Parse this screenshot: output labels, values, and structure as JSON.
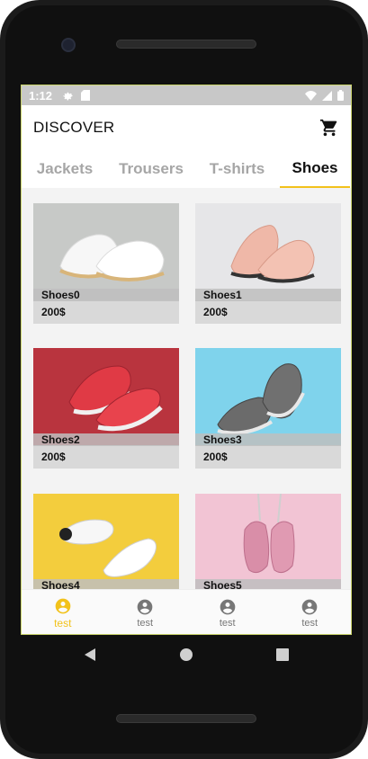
{
  "status_bar": {
    "time": "1:12"
  },
  "app_bar": {
    "title": "DISCOVER"
  },
  "tabs": [
    {
      "label": "Jackets",
      "active": false
    },
    {
      "label": "Trousers",
      "active": false
    },
    {
      "label": "T-shirts",
      "active": false
    },
    {
      "label": "Shoes",
      "active": true
    }
  ],
  "products": [
    {
      "name": "Shoes0",
      "price": "200$"
    },
    {
      "name": "Shoes1",
      "price": "200$"
    },
    {
      "name": "Shoes2",
      "price": "200$"
    },
    {
      "name": "Shoes3",
      "price": "200$"
    },
    {
      "name": "Shoes4",
      "price": ""
    },
    {
      "name": "Shoes5",
      "price": ""
    }
  ],
  "bottom_nav": [
    {
      "label": "test",
      "active": true
    },
    {
      "label": "test",
      "active": false
    },
    {
      "label": "test",
      "active": false
    },
    {
      "label": "test",
      "active": false
    }
  ],
  "colors": {
    "accent": "#f2c21b",
    "inactive_tab": "#a6a6a6",
    "status_bar": "#c8c8c8"
  },
  "icons": {
    "status": [
      "settings-icon",
      "sd-card-icon",
      "wifi-icon",
      "signal-icon",
      "battery-icon"
    ],
    "app_bar": "shopping-cart-icon",
    "nav": "account-circle-icon",
    "system": [
      "back-icon",
      "home-icon",
      "recents-icon"
    ]
  }
}
